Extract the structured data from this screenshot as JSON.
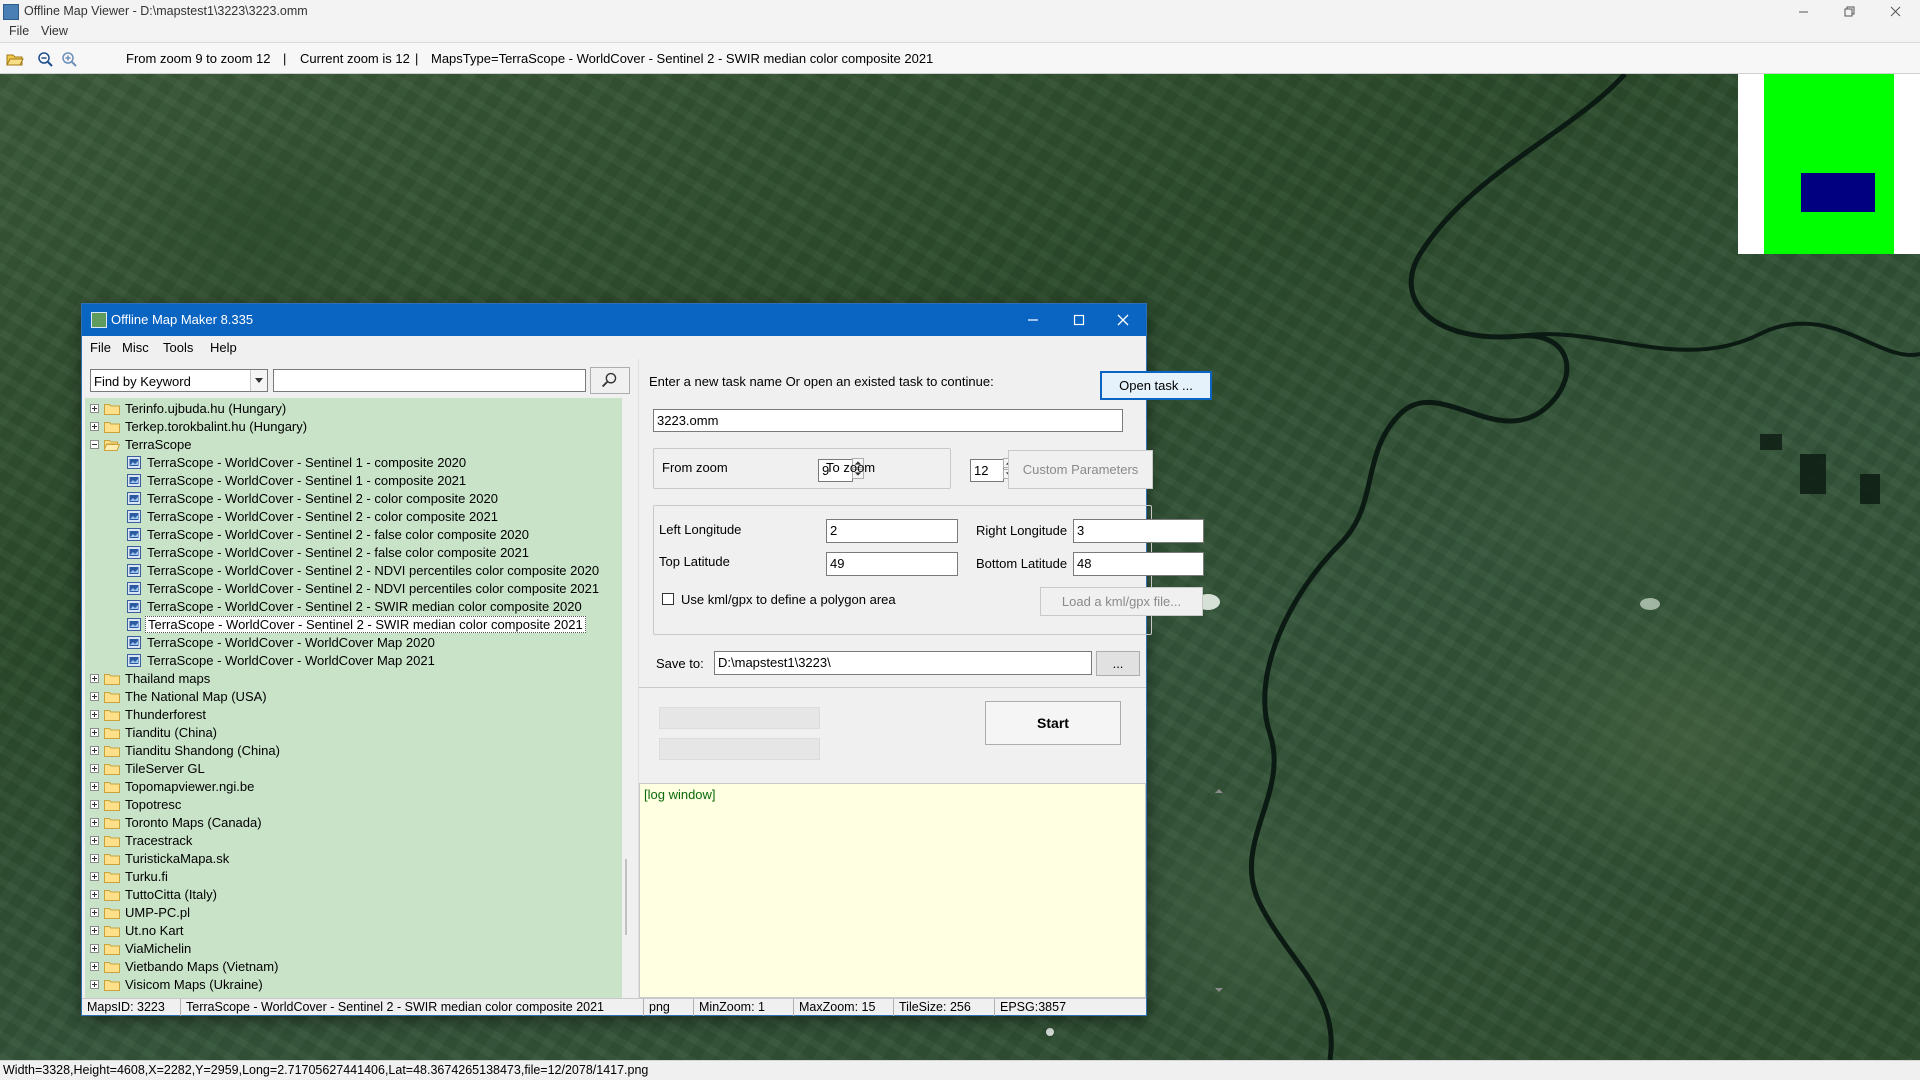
{
  "window": {
    "title": "Offline Map Viewer - D:\\mapstest1\\3223\\3223.omm"
  },
  "menu": {
    "file": "File",
    "view": "View"
  },
  "toolbar": {
    "zoom_range": "From zoom 9 to zoom 12",
    "current_zoom": "Current zoom is 12",
    "maps_type": "MapsType=TerraScope - WorldCover - Sentinel 2 - SWIR median color composite 2021",
    "sep": "|"
  },
  "status": {
    "text": "Width=3328,Height=4608,X=2282,Y=2959,Long=2.71705627441406,Lat=48.3674265138473,file=12/2078/1417.png"
  },
  "overview": {
    "bg_color": "#ffffff",
    "map_color": "#00ff00",
    "view_rect_color": "#000080"
  },
  "dialog": {
    "title": "Offline Map Maker 8.335",
    "menu": {
      "file": "File",
      "misc": "Misc",
      "tools": "Tools",
      "help": "Help"
    },
    "search": {
      "mode": "Find by Keyword",
      "query": ""
    },
    "tree": {
      "top_items": [
        "Terinfo.ujbuda.hu (Hungary)",
        "Terkep.torokbalint.hu (Hungary)"
      ],
      "expanded": "TerraScope",
      "children": [
        "TerraScope - WorldCover - Sentinel 1 - composite 2020",
        "TerraScope - WorldCover - Sentinel 1 - composite 2021",
        "TerraScope - WorldCover - Sentinel 2 - color composite 2020",
        "TerraScope - WorldCover - Sentinel 2 - color composite 2021",
        "TerraScope - WorldCover - Sentinel 2 - false color composite 2020",
        "TerraScope - WorldCover - Sentinel 2 - false color composite 2021",
        "TerraScope - WorldCover - Sentinel 2 - NDVI percentiles color composite 2020",
        "TerraScope - WorldCover - Sentinel 2 - NDVI percentiles color composite 2021",
        "TerraScope - WorldCover - Sentinel 2 - SWIR median color composite 2020",
        "TerraScope - WorldCover - Sentinel 2 - SWIR median color composite 2021",
        "TerraScope - WorldCover - WorldCover Map 2020",
        "TerraScope - WorldCover - WorldCover Map 2021"
      ],
      "selected": "TerraScope - WorldCover - Sentinel 2 - SWIR median color composite 2021",
      "after_items": [
        "Thailand maps",
        "The National Map (USA)",
        "Thunderforest",
        "Tianditu (China)",
        "Tianditu Shandong (China)",
        "TileServer GL",
        "Topomapviewer.ngi.be",
        "Topotresc",
        "Toronto Maps (Canada)",
        "Tracestrack",
        "TuristickaMapa.sk",
        "Turku.fi",
        "TuttoCitta (Italy)",
        "UMP-PC.pl",
        "Ut.no Kart",
        "ViaMichelin",
        "Vietbando Maps (Vietnam)",
        "Visicom Maps (Ukraine)"
      ]
    },
    "task": {
      "prompt": "Enter a new task name Or open an existed task to continue:",
      "open_button": "Open task ...",
      "name": "3223.omm",
      "from_zoom_label": "From zoom",
      "from_zoom": "9",
      "to_zoom_label": "To zoom",
      "to_zoom": "12",
      "custom_params": "Custom Parameters",
      "left_lon_label": "Left Longitude",
      "left_lon": "2",
      "right_lon_label": "Right Longitude",
      "right_lon": "3",
      "top_lat_label": "Top Latitude",
      "top_lat": "49",
      "bottom_lat_label": "Bottom Latitude",
      "bottom_lat": "48",
      "kml_label": "Use kml/gpx to define a polygon area",
      "kml_button": "Load a kml/gpx file...",
      "save_label": "Save to:",
      "save_path": "D:\\mapstest1\\3223\\",
      "browse": "...",
      "start": "Start",
      "log": "[log window]"
    },
    "statusbar": {
      "maps_id": "MapsID: 3223",
      "map_name": "TerraScope - WorldCover - Sentinel 2 - SWIR median color composite 2021",
      "format": "png",
      "min_zoom": "MinZoom: 1",
      "max_zoom": "MaxZoom: 15",
      "tile_size": "TileSize: 256",
      "epsg": "EPSG:3857"
    }
  }
}
